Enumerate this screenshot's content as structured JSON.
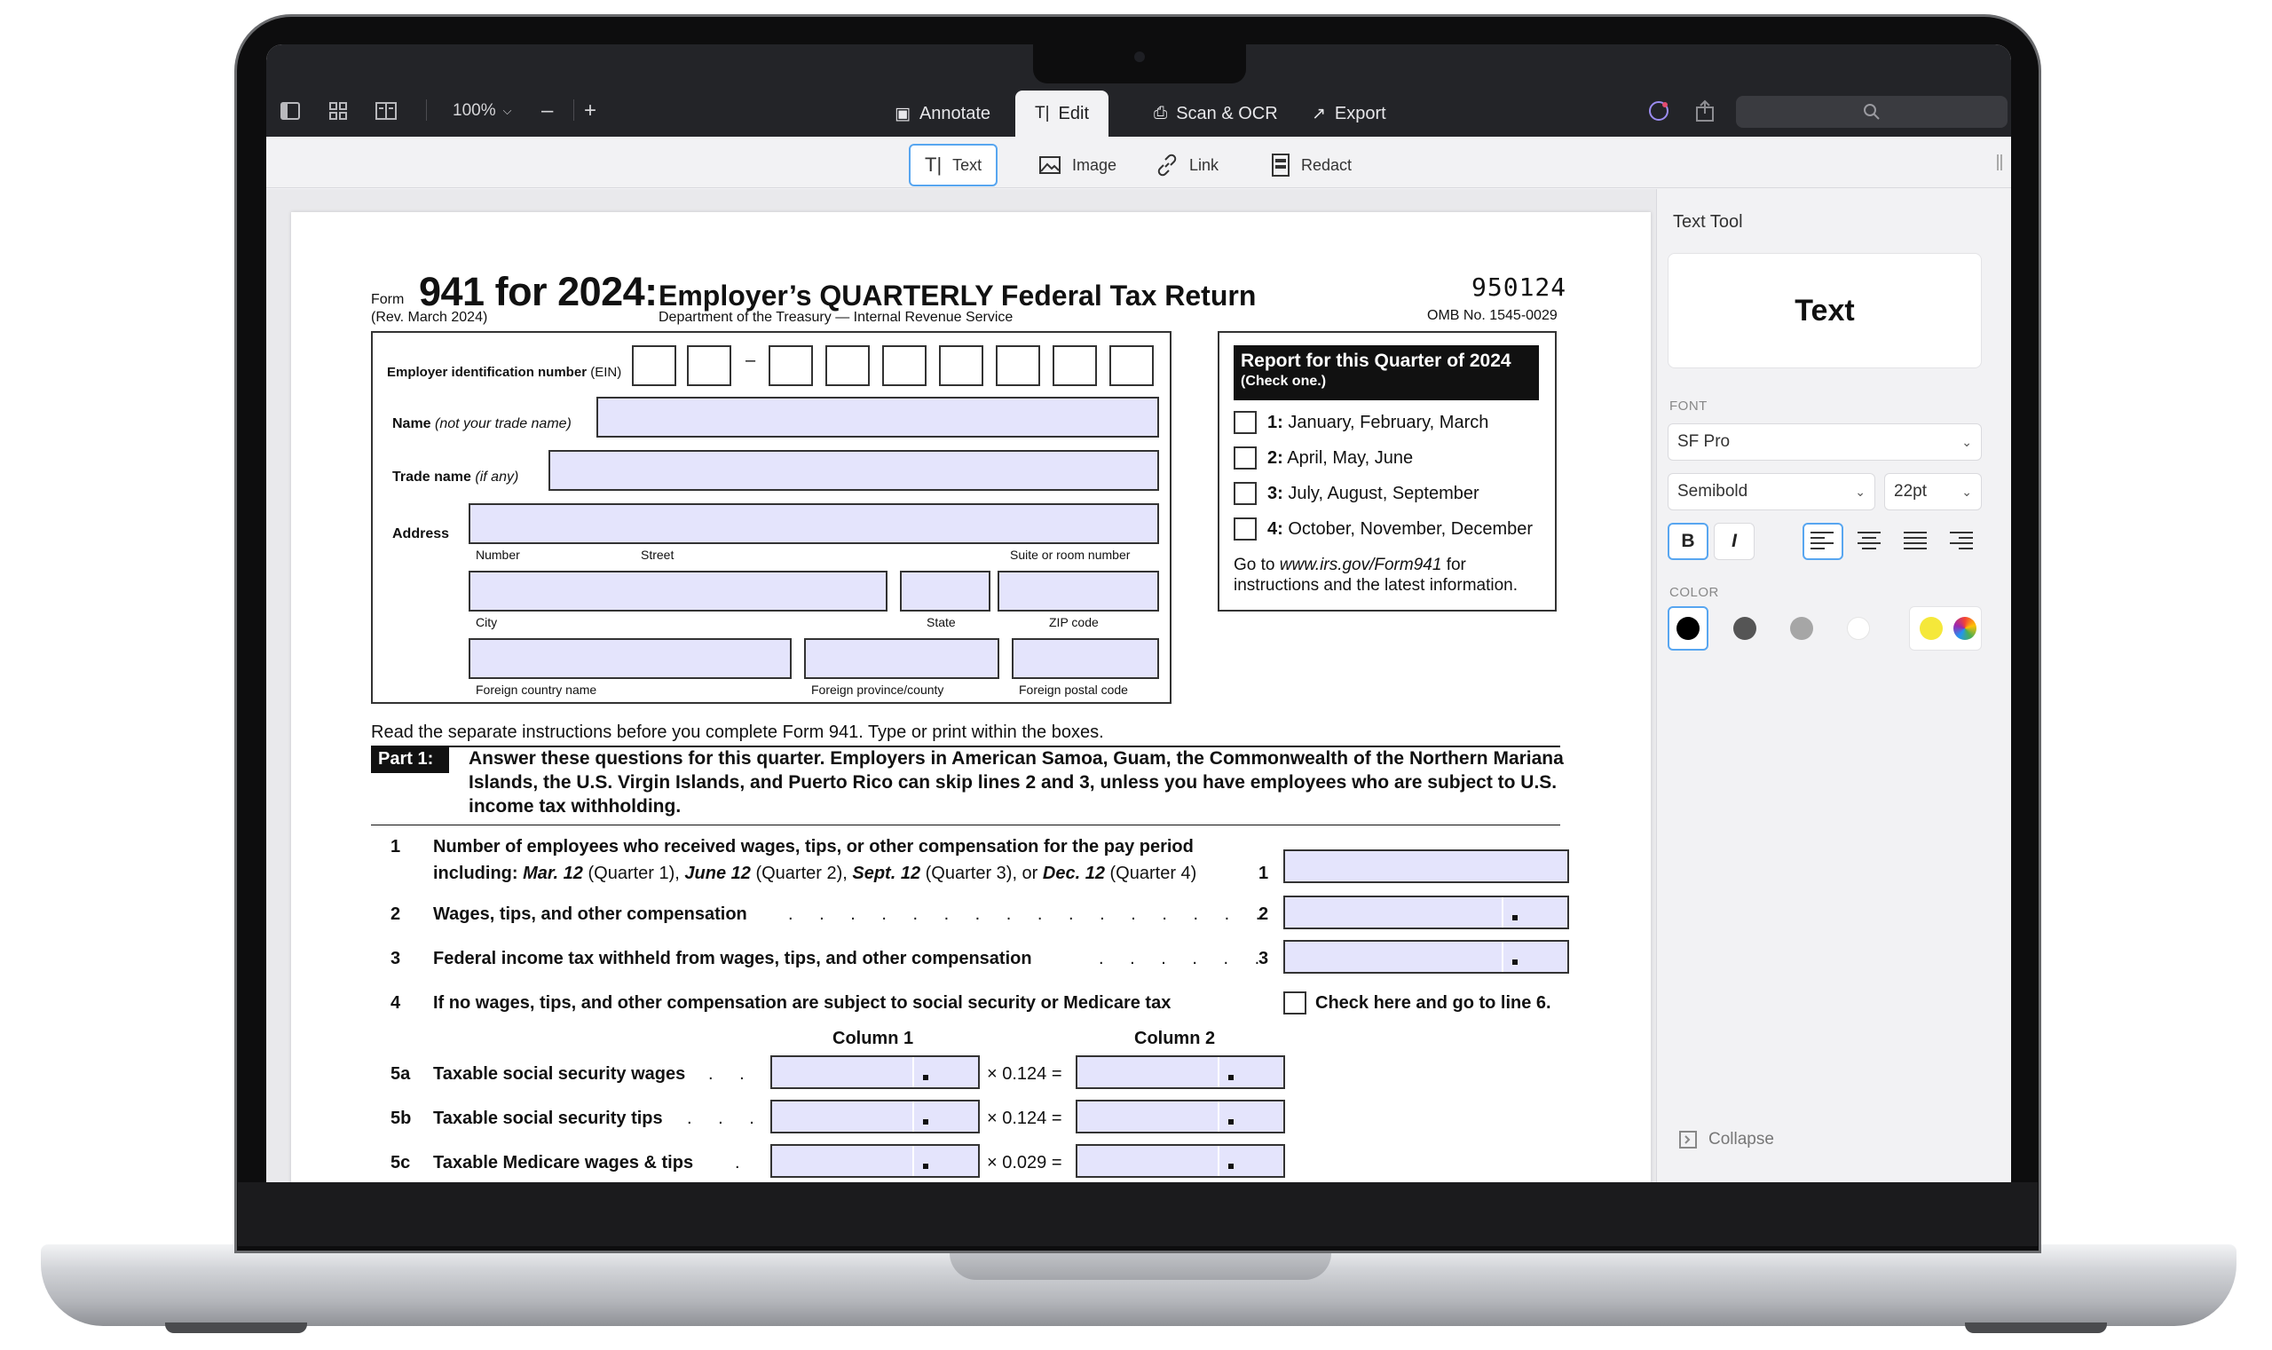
{
  "toolbar": {
    "zoom": "100%",
    "tabs": [
      {
        "label": "Annotate",
        "icon": "annotate-icon"
      },
      {
        "label": "Edit",
        "icon": "text-cursor-icon"
      },
      {
        "label": "Scan & OCR",
        "icon": "scan-icon"
      },
      {
        "label": "Export",
        "icon": "export-icon"
      }
    ],
    "active_tab": "Edit"
  },
  "edit_tools": [
    {
      "label": "Text",
      "icon": "text-tool-icon"
    },
    {
      "label": "Image",
      "icon": "image-icon"
    },
    {
      "label": "Link",
      "icon": "link-icon"
    },
    {
      "label": "Redact",
      "icon": "redact-icon"
    }
  ],
  "form": {
    "form_word": "Form",
    "number": "941 for 2024:",
    "title": "Employer’s QUARTERLY Federal Tax Return",
    "revision": "(Rev. March 2024)",
    "department": "Department of the Treasury — Internal Revenue Service",
    "code": "950124",
    "omb": "OMB No. 1545-0029",
    "ein_label": "Employer identification number",
    "ein_suffix": "(EIN)",
    "ein_dash": "–",
    "name_label": "Name",
    "name_hint": "(not your trade name)",
    "trade_label": "Trade name",
    "trade_hint": "(if any)",
    "address_label": "Address",
    "addr_number": "Number",
    "addr_street": "Street",
    "addr_suite": "Suite or room number",
    "addr_city": "City",
    "addr_state": "State",
    "addr_zip": "ZIP code",
    "addr_fcountry": "Foreign country name",
    "addr_fprovince": "Foreign province/county",
    "addr_fpostal": "Foreign postal code",
    "quarter_title": "Report for this Quarter of 2024",
    "quarter_sub": "(Check one.)",
    "quarters": [
      {
        "num": "1:",
        "text": "January, February, March"
      },
      {
        "num": "2:",
        "text": "April, May, June"
      },
      {
        "num": "3:",
        "text": "July, August, September"
      },
      {
        "num": "4:",
        "text": "October, November, December"
      }
    ],
    "quarter_foot_pre": "Go to ",
    "quarter_foot_link": "www.irs.gov/Form941",
    "quarter_foot_post": " for instructions and the latest information.",
    "read_sep": "Read the separate instructions before you complete Form 941. Type or print within the boxes.",
    "part_label": "Part 1:",
    "part_text": "Answer these questions for this quarter. Employers in American Samoa, Guam, the Commonwealth of the Northern Mariana Islands, the U.S. Virgin Islands, and Puerto Rico can skip lines 2 and 3, unless you have employees who are subject to U.S. income tax withholding.",
    "line1_num": "1",
    "line1_a": "Number of employees who received wages, tips, or other compensation for the pay period",
    "line1_b_pre": "including: ",
    "line1_b_d1": "Mar. 12",
    "line1_b_q1": " (Quarter 1), ",
    "line1_b_d2": "June 12",
    "line1_b_q2": " (Quarter 2), ",
    "line1_b_d3": "Sept. 12",
    "line1_b_q3": " (Quarter 3), or ",
    "line1_b_d4": "Dec. 12",
    "line1_b_q4": " (Quarter 4)",
    "line1_box": "1",
    "line2_num": "2",
    "line2": "Wages, tips, and other compensation",
    "line2_box": "2",
    "line3_num": "3",
    "line3": "Federal income tax withheld from wages, tips, and other compensation",
    "line3_box": "3",
    "line4_num": "4",
    "line4": "If no wages, tips, and other compensation are subject to social security or Medicare tax",
    "line4_check": "Check here and go to line 6.",
    "col1": "Column 1",
    "col2": "Column 2",
    "line5a_num": "5a",
    "line5a": "Taxable social security wages",
    "line5a_rate": "× 0.124 =",
    "line5b_num": "5b",
    "line5b": "Taxable social security tips",
    "line5b_rate": "× 0.124 =",
    "line5c_num": "5c",
    "line5c": "Taxable Medicare wages & tips",
    "line5c_rate": "× 0.029 ="
  },
  "panel": {
    "title": "Text Tool",
    "preview": "Text",
    "font_section": "FONT",
    "font": "SF Pro",
    "weight": "Semibold",
    "size": "22pt",
    "bold": "B",
    "italic": "I",
    "color_section": "COLOR",
    "colors": [
      "#000000",
      "#555555",
      "#a6a6a6",
      "#ffffff",
      "#f5e83a"
    ],
    "collapse": "Collapse"
  }
}
